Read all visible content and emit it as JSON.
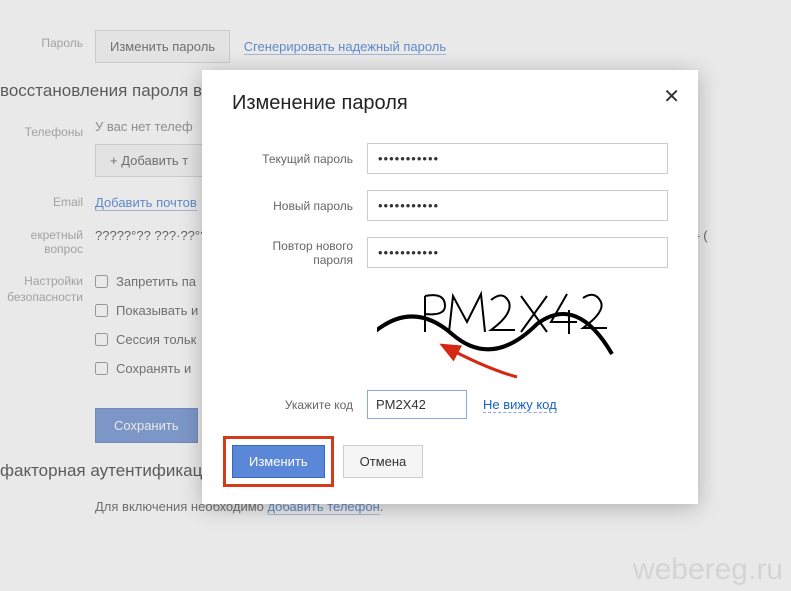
{
  "page": {
    "password_label": "Пароль",
    "change_password_btn": "Изменить пароль",
    "generate_link": "Сгенерировать надежный пароль",
    "restore_title": "восстановления пароля вы мо",
    "phones_label": "Телефоны",
    "no_phone_text": "У вас нет телеф",
    "add_phone_btn": "+ Добавить т",
    "email_label": "Email",
    "add_email_link": "Добавить почтов",
    "secret_label": "екретный вопрос",
    "secret_value": "?????°?? ???·??°??????????°?? ???????????????° ??? ?????????°??????????                                              °?????????????° – (",
    "settings_label": "Настройки безопасности",
    "chk1": "Запретить па",
    "chk2": "Показывать и",
    "chk3": "Сессия тольк",
    "chk4": "Сохранять и",
    "save_btn": "Сохранить",
    "twofa_title": "факторная аутентификация",
    "twofa_text_pre": "Для включения необходимо ",
    "twofa_link": "добавить телефон",
    "twofa_text_post": "."
  },
  "modal": {
    "title": "Изменение пароля",
    "current_pw_label": "Текущий пароль",
    "new_pw_label": "Новый пароль",
    "repeat_pw_label": "Повтор нового пароля",
    "pw_value": "•••••••••••",
    "captcha_text": "PM2X42",
    "code_label": "Укажите код",
    "code_value": "PM2X42",
    "no_see_link": "Не вижу код",
    "submit_btn": "Изменить",
    "cancel_btn": "Отмена"
  },
  "watermark": "webereg.ru"
}
